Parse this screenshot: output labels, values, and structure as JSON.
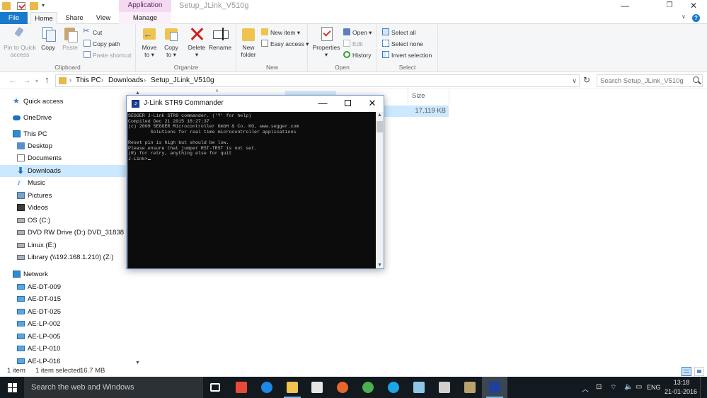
{
  "titlebar": {
    "contextual_tab": "Application Tools",
    "window_title": "Setup_JLink_V510g",
    "minimize": "—",
    "restore": "❐",
    "close": "✕"
  },
  "ribbon_tabs": {
    "file": "File",
    "home": "Home",
    "share": "Share",
    "view": "View",
    "manage": "Manage"
  },
  "ribbon": {
    "clipboard": {
      "group_label": "Clipboard",
      "pin_line1": "Pin to Quick",
      "pin_line2": "access",
      "copy": "Copy",
      "paste": "Paste",
      "cut": "Cut",
      "copy_path": "Copy path",
      "paste_shortcut": "Paste shortcut"
    },
    "organize": {
      "group_label": "Organize",
      "move_line1": "Move",
      "move_line2": "to",
      "copy_line1": "Copy",
      "copy_line2": "to",
      "delete": "Delete",
      "rename": "Rename"
    },
    "new": {
      "group_label": "New",
      "new_folder_line1": "New",
      "new_folder_line2": "folder",
      "new_item": "New item",
      "easy_access": "Easy access"
    },
    "open": {
      "group_label": "Open",
      "properties": "Properties",
      "open": "Open",
      "edit": "Edit",
      "history": "History"
    },
    "select": {
      "group_label": "Select",
      "select_all": "Select all",
      "select_none": "Select none",
      "invert_selection": "Invert selection"
    }
  },
  "address_bar": {
    "crumbs": [
      "This PC",
      "Downloads",
      "Setup_JLink_V510g"
    ],
    "search_placeholder": "Search Setup_JLink_V510g"
  },
  "nav_pane": {
    "items": [
      {
        "label": "Quick access",
        "icon": "star-icon"
      },
      {
        "label": "OneDrive",
        "icon": "cloud-icon"
      },
      {
        "label": "This PC",
        "icon": "computer-icon"
      },
      {
        "label": "Desktop",
        "icon": "desktop-folder-icon"
      },
      {
        "label": "Documents",
        "icon": "documents-icon"
      },
      {
        "label": "Downloads",
        "icon": "download-arrow-icon",
        "selected": true
      },
      {
        "label": "Music",
        "icon": "music-note-icon"
      },
      {
        "label": "Pictures",
        "icon": "pictures-icon"
      },
      {
        "label": "Videos",
        "icon": "videos-icon"
      },
      {
        "label": "OS (C:)",
        "icon": "drive-icon"
      },
      {
        "label": "DVD RW Drive (D:) DVD_31838",
        "icon": "dvd-drive-icon"
      },
      {
        "label": "Linux (E:)",
        "icon": "drive-icon"
      },
      {
        "label": "Library (\\\\192.168.1.210) (Z:)",
        "icon": "network-drive-icon"
      },
      {
        "label": "Network",
        "icon": "network-icon"
      },
      {
        "label": "AE-DT-009",
        "icon": "network-computer-icon"
      },
      {
        "label": "AE-DT-015",
        "icon": "network-computer-icon"
      },
      {
        "label": "AE-DT-025",
        "icon": "network-computer-icon"
      },
      {
        "label": "AE-LP-002",
        "icon": "network-computer-icon"
      },
      {
        "label": "AE-LP-005",
        "icon": "network-computer-icon"
      },
      {
        "label": "AE-LP-010",
        "icon": "network-computer-icon"
      },
      {
        "label": "AE-LP-016",
        "icon": "network-computer-icon"
      }
    ]
  },
  "file_list": {
    "col_size": "Size",
    "selected_file_size": "17,119 KB"
  },
  "status_bar": {
    "item_count": "1 item",
    "selected": "1 item selected",
    "size": "16.7 MB"
  },
  "console": {
    "title": "J-Link STR9 Commander",
    "lines": [
      "SEGGER J-Link STR9 commander. ('?' for help)",
      "Compiled Dec 21 2015 18:27:37",
      "(c) 2009 SEGGER Microcontroller GmbH & Co. KG, www.segger.com",
      "        Solutions for real time microcontroller applications",
      "",
      "Reset pin is high but should be low.",
      "Please ensure that jumper RST-TRST is not set.",
      "(R) for retry, anything else for quit"
    ],
    "prompt": "J-Link>"
  },
  "taskbar": {
    "search_text": "Search the web and Windows",
    "apps": [
      {
        "name": "task-view-icon",
        "color": "#ffffff"
      },
      {
        "name": "app-grid-icon",
        "color": "#e84a3a"
      },
      {
        "name": "edge-icon",
        "color": "#1e88e5"
      },
      {
        "name": "file-explorer-icon",
        "color": "#f0c34e",
        "running": true
      },
      {
        "name": "store-icon",
        "color": "#e6e6e6"
      },
      {
        "name": "firefox-icon",
        "color": "#e8662a"
      },
      {
        "name": "chrome-icon",
        "color": "#4caf50"
      },
      {
        "name": "skype-icon",
        "color": "#1ea4e9"
      },
      {
        "name": "notepad-icon",
        "color": "#8fc6e8"
      },
      {
        "name": "search-tool-icon",
        "color": "#d0d0d0"
      },
      {
        "name": "tool-icon",
        "color": "#b9a36a"
      },
      {
        "name": "jlink-icon",
        "color": "#1f3f9a",
        "running": true,
        "active": true
      }
    ],
    "tray": {
      "language": "ENG",
      "time": "13:18",
      "date": "21-01-2016"
    }
  }
}
